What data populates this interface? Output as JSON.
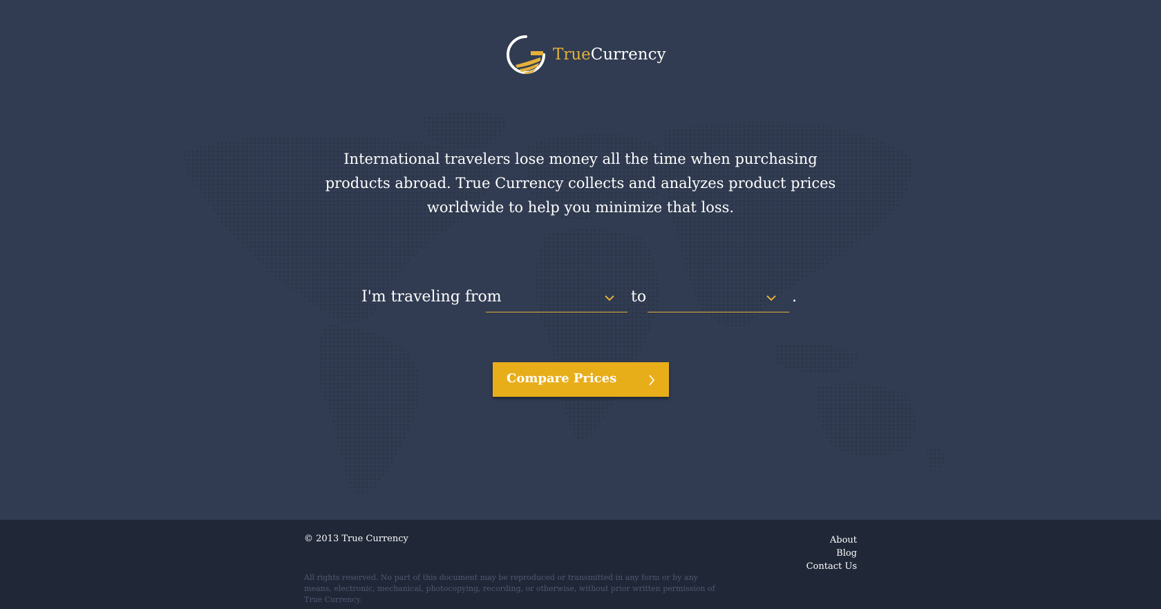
{
  "brand": {
    "name_part1": "True",
    "name_part2": "Currency",
    "accent_color": "#e4b03a",
    "logo_icon": "coin-swirl-logo-icon"
  },
  "intro": {
    "text": "International travelers lose money all the time when purchasing products abroad. True Currency collects and analyzes product prices worldwide to help you minimize that loss."
  },
  "form": {
    "prefix": "I'm traveling from",
    "from_value": "",
    "connector": "to",
    "to_value": "",
    "suffix": ".",
    "dropdown_icon": "chevron-down-icon"
  },
  "cta": {
    "label": "Compare Prices",
    "icon": "chevron-right-icon",
    "color": "#e8ae1a"
  },
  "footer": {
    "copyright": "© 2013 True Currency",
    "legal": "All rights reserved. No part of this document may be reproduced or transmitted in any form or by any means, electronic, mechanical, photocopying, recording, or otherwise, without prior written permission of True Currency.",
    "links": [
      {
        "label": "About"
      },
      {
        "label": "Blog"
      },
      {
        "label": "Contact Us"
      }
    ]
  },
  "colors": {
    "background": "#313c52",
    "footer_background": "#202737"
  }
}
